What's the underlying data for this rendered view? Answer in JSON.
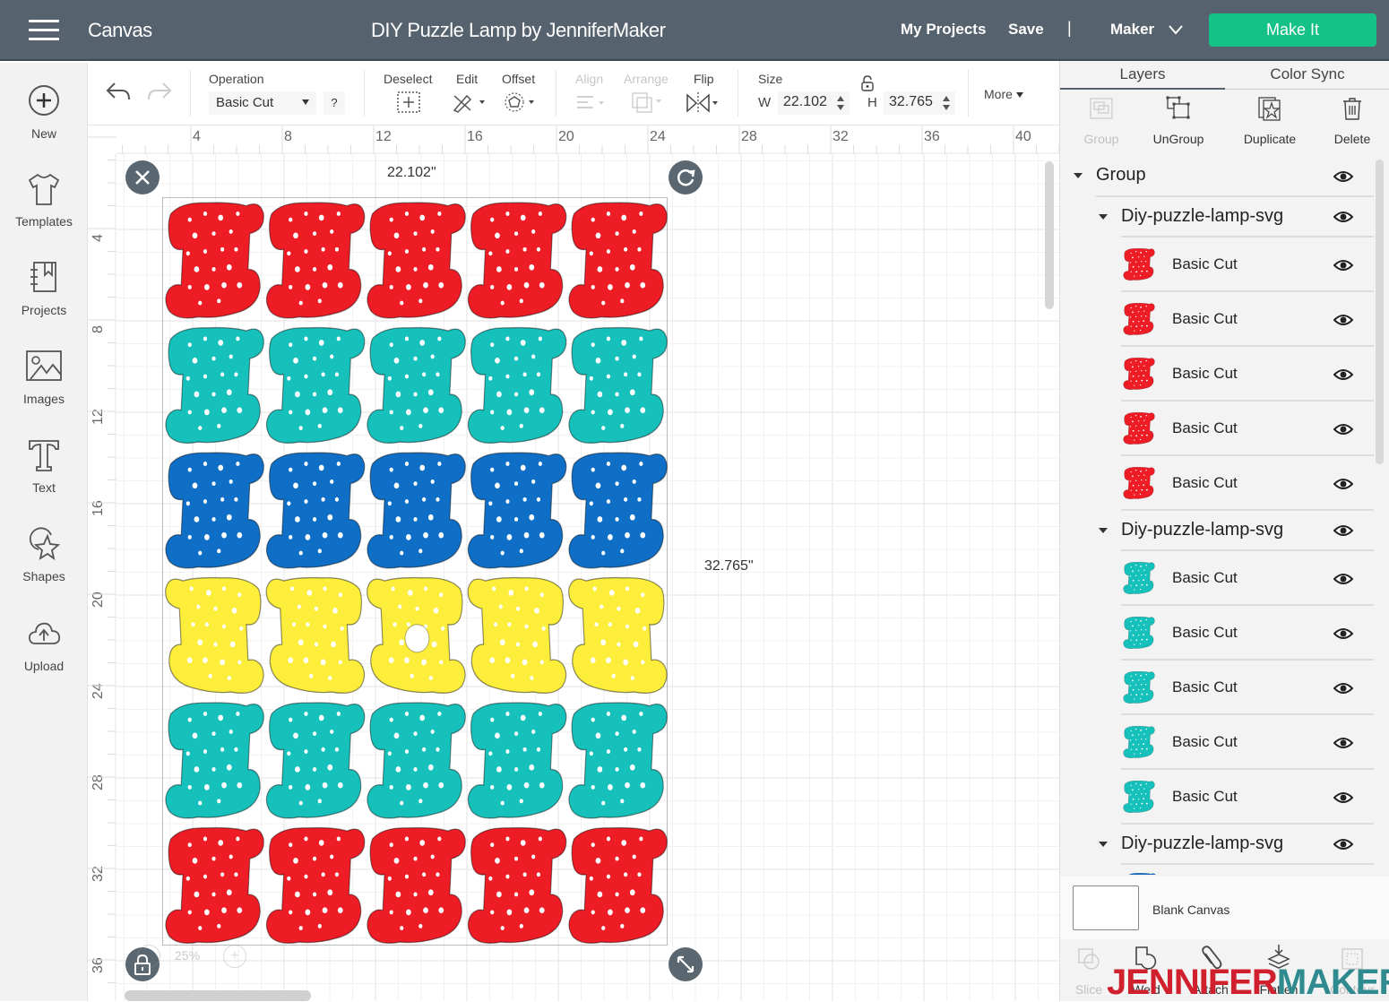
{
  "header": {
    "app_title": "Canvas",
    "project_title": "DIY Puzzle Lamp by JenniferMaker",
    "my_projects": "My Projects",
    "save": "Save",
    "separator": "|",
    "machine": "Maker",
    "make_it": "Make It",
    "make_it_color": "#14c187"
  },
  "sidebar": {
    "items": [
      {
        "label": "New",
        "icon": "plus-circle-icon"
      },
      {
        "label": "Templates",
        "icon": "tshirt-icon"
      },
      {
        "label": "Projects",
        "icon": "notebook-icon"
      },
      {
        "label": "Images",
        "icon": "image-icon"
      },
      {
        "label": "Text",
        "icon": "text-t-icon"
      },
      {
        "label": "Shapes",
        "icon": "shapes-icon"
      },
      {
        "label": "Upload",
        "icon": "cloud-upload-icon"
      }
    ]
  },
  "toolbar": {
    "operation_label": "Operation",
    "operation_value": "Basic Cut",
    "help": "?",
    "deselect": "Deselect",
    "edit": "Edit",
    "offset": "Offset",
    "align": "Align",
    "arrange": "Arrange",
    "flip": "Flip",
    "size": "Size",
    "w_label": "W",
    "w_value": "22.102",
    "h_label": "H",
    "h_value": "32.765",
    "more": "More"
  },
  "canvas": {
    "h_ruler": [
      "4",
      "8",
      "12",
      "16",
      "20",
      "24",
      "28",
      "32",
      "36",
      "40"
    ],
    "v_ruler": [
      "4",
      "8",
      "12",
      "16",
      "20",
      "24",
      "28",
      "32",
      "36"
    ],
    "width_readout": "22.102\"",
    "height_readout": "32.765\"",
    "zoom_level": "25%",
    "rows": [
      {
        "color": "#ee1c25",
        "count": 5
      },
      {
        "color": "#17c1bb",
        "count": 5
      },
      {
        "color": "#0f6fc6",
        "count": 5
      },
      {
        "color": "#fcee3b",
        "count": 5,
        "center_hole_index": 2
      },
      {
        "color": "#17c1bb",
        "count": 5
      },
      {
        "color": "#ee1c25",
        "count": 5
      }
    ]
  },
  "right_panel": {
    "tabs": [
      "Layers",
      "Color Sync"
    ],
    "actions": [
      {
        "label": "Group",
        "enabled": false
      },
      {
        "label": "UnGroup",
        "enabled": true
      },
      {
        "label": "Duplicate",
        "enabled": true
      },
      {
        "label": "Delete",
        "enabled": true
      }
    ],
    "layers": {
      "group_name": "Group",
      "subgroups": [
        {
          "name": "Diy-puzzle-lamp-svg",
          "color": "#ee1c25",
          "items": [
            "Basic Cut",
            "Basic Cut",
            "Basic Cut",
            "Basic Cut",
            "Basic Cut"
          ]
        },
        {
          "name": "Diy-puzzle-lamp-svg",
          "color": "#17c1bb",
          "items": [
            "Basic Cut",
            "Basic Cut",
            "Basic Cut",
            "Basic Cut",
            "Basic Cut"
          ]
        },
        {
          "name": "Diy-puzzle-lamp-svg",
          "color": "#0f6fc6",
          "items": []
        }
      ]
    },
    "blank_canvas": "Blank Canvas",
    "bottom_tools": [
      {
        "label": "Slice",
        "enabled": false
      },
      {
        "label": "Weld",
        "enabled": true
      },
      {
        "label": "Attach",
        "enabled": true
      },
      {
        "label": "Flatten",
        "enabled": true
      },
      {
        "label": "Contour",
        "enabled": false
      }
    ],
    "watermark": {
      "part1": "JENNIFER",
      "part2": "MAKER"
    }
  }
}
